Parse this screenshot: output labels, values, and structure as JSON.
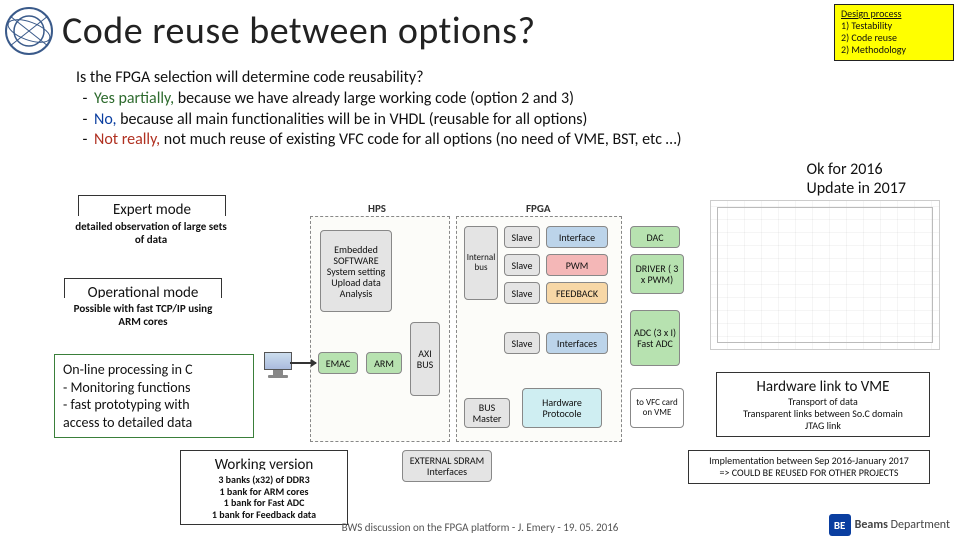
{
  "title": "Code reuse between options?",
  "design_process": {
    "heading": "Design process",
    "l1": "1) Testability",
    "l2": "2) Code reuse",
    "l3": "2) Methodology"
  },
  "body": {
    "q": "Is the FPGA selection will determine code reusability?",
    "a1_lead": "Yes partially,",
    "a1_rest": " because we have already large working code (option 2 and 3)",
    "a2_lead": "No,",
    "a2_rest": " because all main functionalities will be in VHDL (reusable for all options)",
    "a3_lead": "Not really,",
    "a3_rest": " not much reuse of existing VFC code for all options (no need of VME, BST, etc …)"
  },
  "ok2016": {
    "l1": "Ok for 2016",
    "l2": "Update in 2017"
  },
  "expert": {
    "title": "Expert mode",
    "sub": "detailed observation of large sets of data"
  },
  "opmode": {
    "title": "Operational mode",
    "sub": "Possible with fast TCP/IP using ARM cores"
  },
  "online": {
    "l1": "On-line processing in C",
    "l2": "- Monitoring functions",
    "l3": "- fast prototyping with",
    "l4": "access to detailed data"
  },
  "working": {
    "title": "Working version",
    "s1": "3 banks (x32) of DDR3",
    "s2": "1 bank for ARM cores",
    "s3": "1 bank for Fast ADC",
    "s4": "1 bank for Feedback data"
  },
  "hw_vme": {
    "title": "Hardware link to VME",
    "s1": "Transport of data",
    "s2": "Transparent links between So.C domain",
    "s3": "JTAG link"
  },
  "impl": {
    "l1": "Implementation between Sep 2016-January 2017",
    "l2": "=> COULD BE REUSED FOR OTHER PROJECTS"
  },
  "diagram": {
    "hps": "HPS",
    "fpga": "FPGA",
    "embedded": "Embedded SOFTWARE System setting Upload data Analysis",
    "emac": "EMAC",
    "arm": "ARM",
    "axi": "AXI BUS",
    "intbus": "Internal bus",
    "slave": "Slave",
    "busmaster": "BUS Master",
    "interface": "Interface",
    "interfaces": "Interfaces",
    "pwm": "PWM",
    "feedback": "FEEDBACK",
    "hwproto": "Hardware Protocole",
    "dac": "DAC",
    "driver": "DRIVER ( 3 x PWM)",
    "adc": "ADC (3 x I) Fast ADC",
    "tovfc": "to VFC card on VME",
    "sdram": "EXTERNAL SDRAM Interfaces"
  },
  "footer": "BWS discussion on the FPGA platform - J. Emery - 19. 05. 2016",
  "beams": {
    "badge": "BE",
    "t1": "Beams",
    "t2": " Department"
  }
}
